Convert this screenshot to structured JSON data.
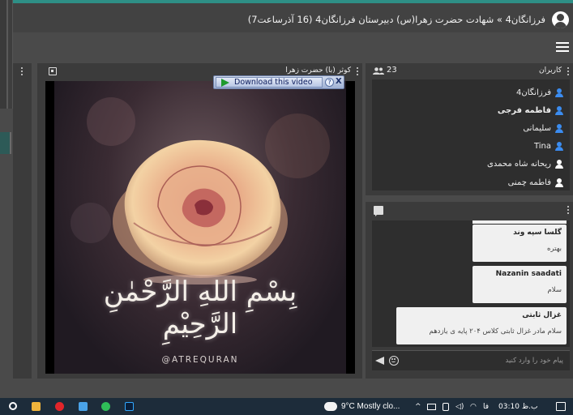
{
  "header": {
    "title": "فرزانگان4 » شهادت حضرت زهرا(س) دبیرستان فرزانگان4 (16 آذرساعت7)"
  },
  "video_panel": {
    "title": "کوثر (با) حضرت زهرا",
    "download_label": "Download this video",
    "help_glyph": "?",
    "close_glyph": "X",
    "calligraphy": "بِسْمِ اللهِ الرَّحْمٰنِ الرَّحِیْمِ",
    "watermark": "@ATREQURAN"
  },
  "users_panel": {
    "title": "کاربران",
    "count": "23",
    "users": [
      {
        "name": "فرزانگان4",
        "bold": false,
        "icon_color": "#3b8cf0"
      },
      {
        "name": "فاطمه فرجی",
        "bold": true,
        "icon_color": "#3b8cf0"
      },
      {
        "name": "سلیمانی",
        "bold": false,
        "icon_color": "#3b8cf0"
      },
      {
        "name": "Tina",
        "bold": false,
        "icon_color": "#3b8cf0"
      },
      {
        "name": "ریحانه شاه محمدی",
        "bold": false,
        "icon_color": "#ffffff"
      },
      {
        "name": "فاطمه چمنی",
        "bold": false,
        "icon_color": "#ffffff"
      }
    ]
  },
  "chat_panel": {
    "messages": [
      {
        "sender": "گلسا سپه وند",
        "text": "بهتره"
      },
      {
        "sender": "Nazanin saadati",
        "text": "سلام"
      },
      {
        "sender": "غزال ثابتی",
        "text": "سلام   مادر غزال ثابتی کلاس ۲۰۴ پایه ی یازدهم"
      }
    ],
    "input_placeholder": "پیام خود را وارد کنید"
  },
  "taskbar": {
    "weather": "9°C  Mostly clo...",
    "language": "فا",
    "clock": "03:10 ب.ظ"
  },
  "colors": {
    "accent": "#2e8f86",
    "user_icon_blue": "#3b8cf0",
    "panel_bg": "#3b3b3b",
    "list_bg": "#2e2e2e"
  }
}
